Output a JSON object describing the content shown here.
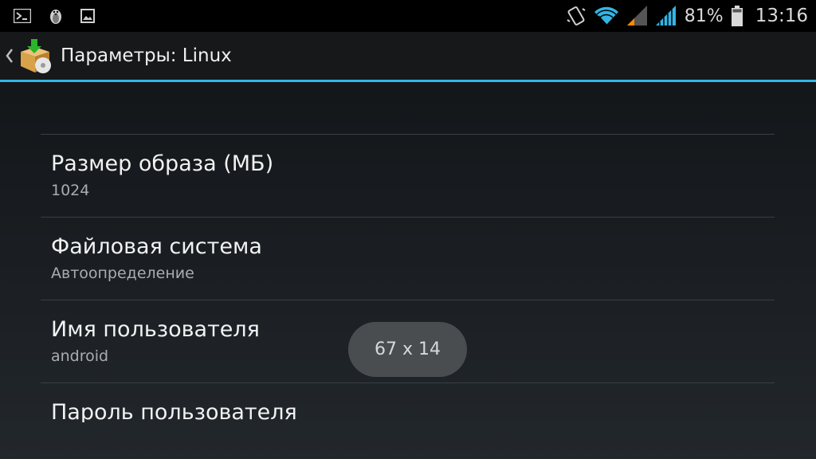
{
  "status_bar": {
    "left_icons": [
      "terminal-icon",
      "penguin-icon",
      "image-icon"
    ],
    "right_icons": [
      "vibrate-icon",
      "wifi-icon",
      "signal-icon",
      "signal-icon"
    ],
    "battery": "81%",
    "time": "13:16"
  },
  "action_bar": {
    "title": "Параметры: Linux",
    "app_icon": "package-install-icon",
    "accent_color": "#33b5e5"
  },
  "settings": [
    {
      "title": "Размер образа (МБ)",
      "summary": "1024"
    },
    {
      "title": "Файловая система",
      "summary": "Автоопределение"
    },
    {
      "title": "Имя пользователя",
      "summary": "android"
    },
    {
      "title": "Пароль пользователя",
      "summary": ""
    }
  ],
  "toast": "67 x 14"
}
